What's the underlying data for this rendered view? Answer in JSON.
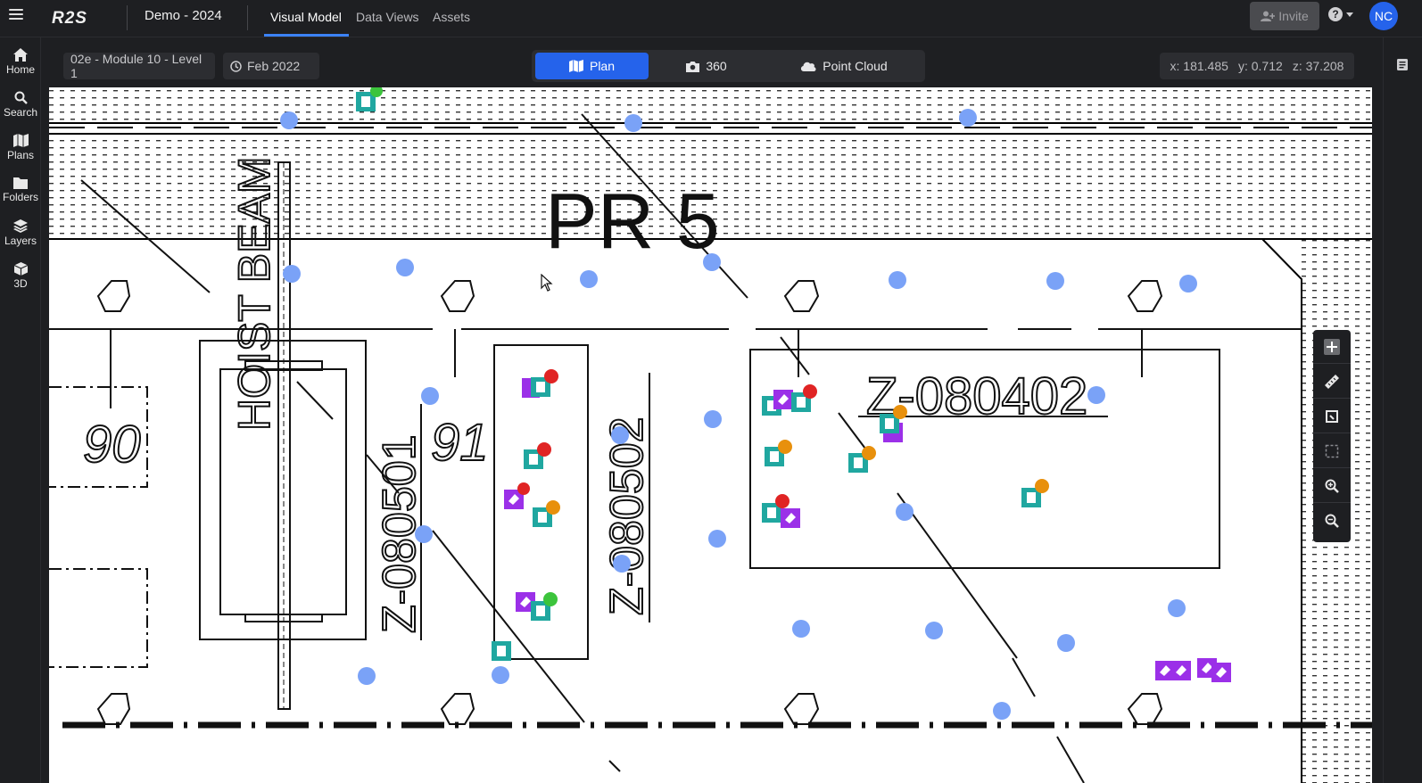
{
  "app": {
    "logo": "R2S",
    "project_name": "Demo - 2024"
  },
  "tabs": [
    {
      "label": "Visual Model",
      "active": true
    },
    {
      "label": "Data Views",
      "active": false
    },
    {
      "label": "Assets",
      "active": false
    }
  ],
  "header": {
    "invite_label": "Invite",
    "avatar_initials": "NC",
    "help_icon": "help-icon"
  },
  "sidebar": {
    "items": [
      {
        "label": "Home",
        "icon": "home-icon"
      },
      {
        "label": "Search",
        "icon": "search-icon"
      },
      {
        "label": "Plans",
        "icon": "map-icon"
      },
      {
        "label": "Folders",
        "icon": "folder-icon"
      },
      {
        "label": "Layers",
        "icon": "layers-icon"
      },
      {
        "label": "3D",
        "icon": "cube-icon"
      }
    ]
  },
  "viewbar": {
    "location": "02e - Module 10 - Level 1",
    "date": "Feb 2022",
    "modes": [
      {
        "label": "Plan",
        "active": true
      },
      {
        "label": "360",
        "active": false
      },
      {
        "label": "Point Cloud",
        "active": false
      }
    ],
    "coords": {
      "x": "x: 181.485",
      "y": "y: 0.712",
      "z": "z: 37.208"
    }
  },
  "drawing": {
    "labels": {
      "pr5": "PR 5",
      "hoist_beam": "HOIST BEAM",
      "grid90": "90",
      "grid91": "91",
      "z080501": "Z-080501",
      "z080502": "Z-080502",
      "z080402": "Z-080402"
    }
  },
  "tools": [
    "plus-icon",
    "ruler-icon",
    "crop-icon",
    "select-box-icon",
    "zoom-in-icon",
    "zoom-out-icon"
  ],
  "colors": {
    "accent": "#2563eb",
    "marker_blue": "#7aa2f7",
    "issue_teal": "#20a7a0",
    "tag_purple": "#9b30e8",
    "status_red": "#e02424",
    "status_orange": "#e8900c",
    "status_green": "#3cc43c"
  }
}
